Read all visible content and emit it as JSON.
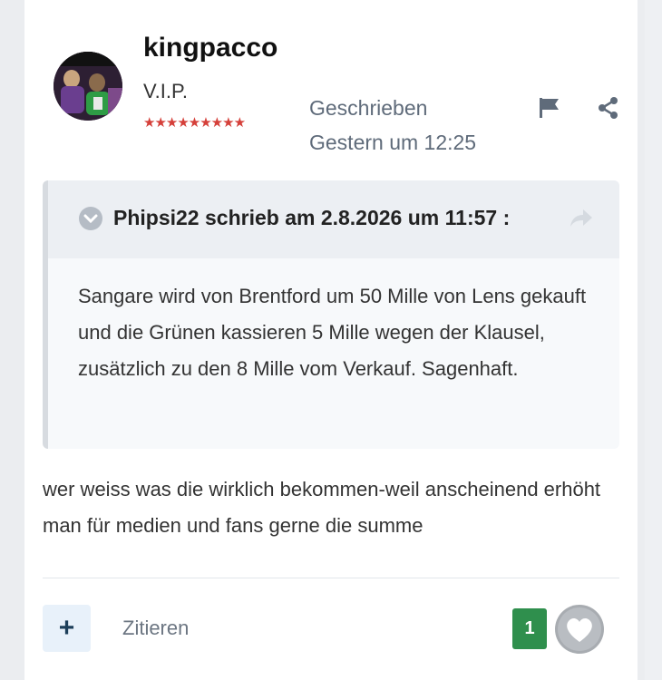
{
  "post": {
    "username": "kingpacco",
    "rank": "V.I.P.",
    "stars": "★★★★★★★★★",
    "meta_label": "Geschrieben",
    "meta_time": "Gestern um 12:25",
    "quote": {
      "author_line": "Phipsi22 schrieb am 2.8.2026 um 11:57 :",
      "text": "Sangare wird von Brentford um 50 Mille von Lens gekauft und die Grünen kassieren 5 Mille wegen der Klausel, zusätzlich zu den 8 Mille vom Verkauf. Sagenhaft."
    },
    "body": "wer weiss was die wirklich bekommen-weil anscheinend erhöht man für medien und fans gerne die summe",
    "footer": {
      "plus_label": "+",
      "quote_label": "Zitieren",
      "like_count": "1"
    }
  },
  "colors": {
    "stars": "#d5403a",
    "like_badge": "#2f8f4d",
    "meta_text": "#5f6b7a"
  },
  "icons": [
    "flag-icon",
    "share-icon",
    "chevron-down-icon",
    "reply-arrow-icon",
    "heart-icon"
  ]
}
